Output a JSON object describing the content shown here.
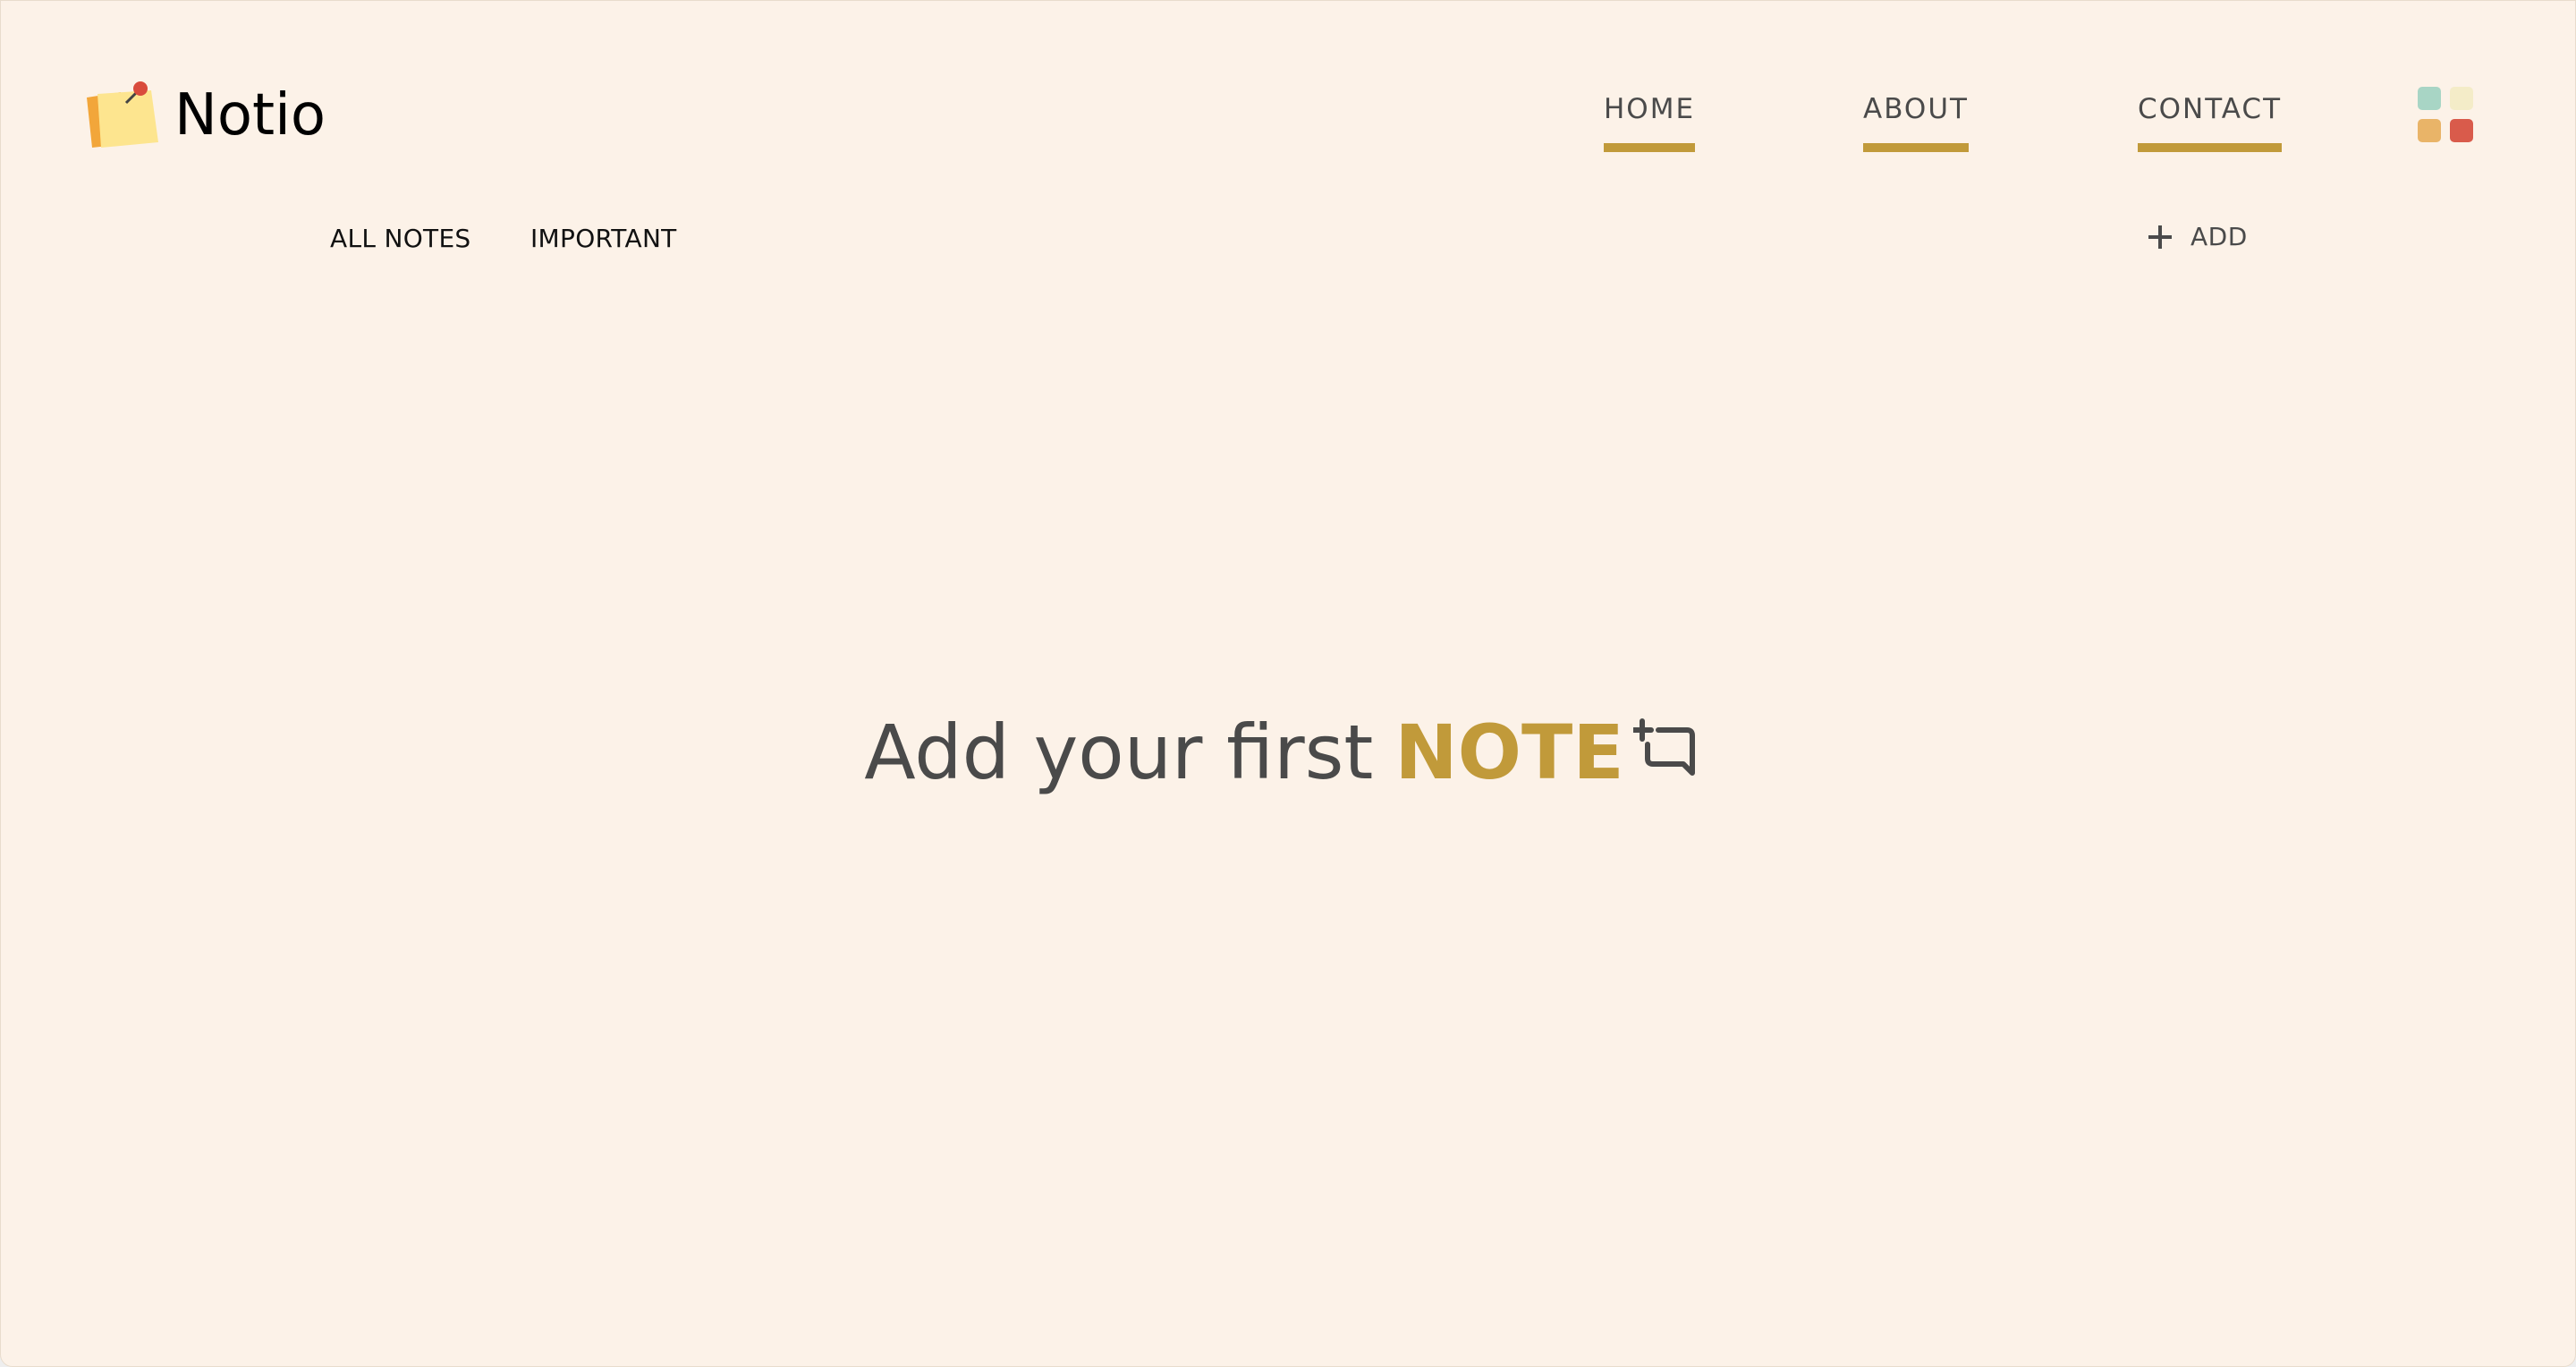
{
  "app": {
    "name": "Notio"
  },
  "nav": {
    "items": [
      {
        "label": "HOME"
      },
      {
        "label": "ABOUT"
      },
      {
        "label": "CONTACT"
      }
    ],
    "theme_colors": [
      "#a8d5c5",
      "#f4ecc8",
      "#e9b468",
      "#d95b4b"
    ]
  },
  "subnav": {
    "all_notes": "ALL NOTES",
    "important": "IMPORTANT",
    "add_label": "ADD"
  },
  "empty_state": {
    "text": "Add your first",
    "accent": "NOTE"
  },
  "colors": {
    "background": "#fcf2e8",
    "accent": "#c19a3a",
    "text": "#4a4a4a"
  },
  "icons": [
    "sticky-note-logo-icon",
    "theme-palette-icon",
    "plus-icon",
    "add-comment-icon"
  ]
}
